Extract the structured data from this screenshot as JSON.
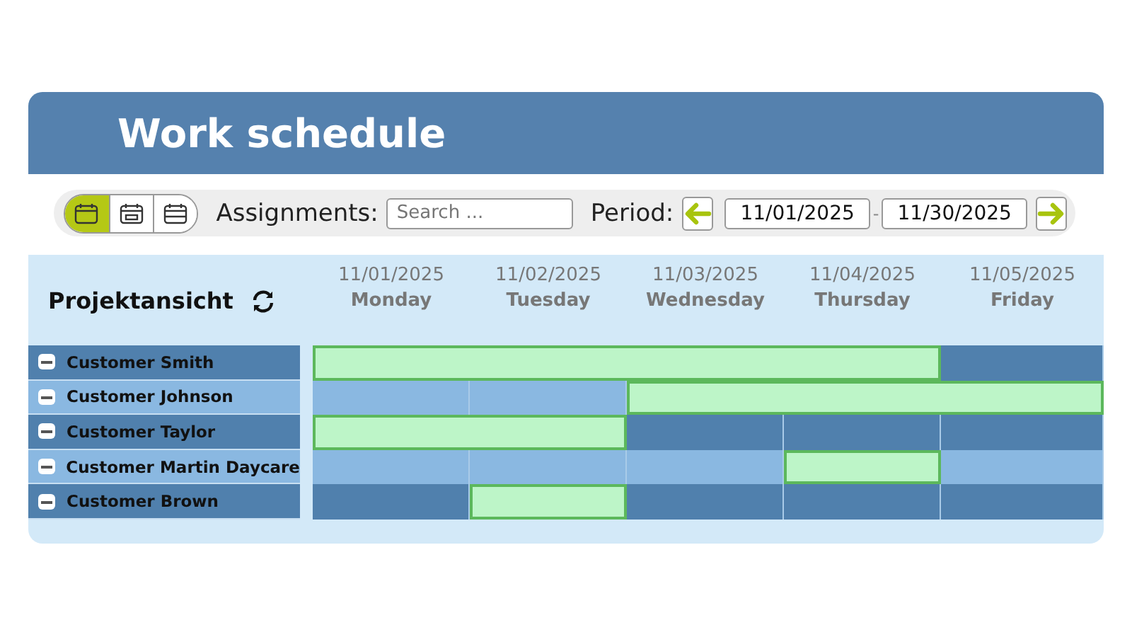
{
  "title": "Work schedule",
  "toolbar": {
    "views": [
      {
        "selected": true
      },
      {
        "selected": false
      },
      {
        "selected": false
      }
    ],
    "assignments_label": "Assignments:",
    "search": {
      "placeholder": "Search ..."
    },
    "period_label": "Period:",
    "start_date": "11/01/2025",
    "separator": "-",
    "end_date": "11/30/2025"
  },
  "calendar": {
    "view_title": "Projektansicht",
    "days": [
      {
        "date": "11/01/2025",
        "weekday": "Monday"
      },
      {
        "date": "11/02/2025",
        "weekday": "Tuesday"
      },
      {
        "date": "11/03/2025",
        "weekday": "Wednesday"
      },
      {
        "date": "11/04/2025",
        "weekday": "Thursday"
      },
      {
        "date": "11/05/2025",
        "weekday": "Friday"
      }
    ],
    "rows": [
      {
        "name": "Customer Smith",
        "expanded": true,
        "booked": [
          true,
          true,
          true,
          true,
          false
        ]
      },
      {
        "name": "Customer Johnson",
        "expanded": true,
        "booked": [
          false,
          false,
          true,
          true,
          true
        ]
      },
      {
        "name": "Customer Taylor",
        "expanded": true,
        "booked": [
          true,
          true,
          false,
          false,
          false
        ]
      },
      {
        "name": "Customer Martin Daycare",
        "expanded": true,
        "booked": [
          false,
          false,
          false,
          true,
          false
        ]
      },
      {
        "name": "Customer Brown",
        "expanded": true,
        "booked": [
          false,
          true,
          false,
          false,
          false
        ]
      }
    ]
  }
}
